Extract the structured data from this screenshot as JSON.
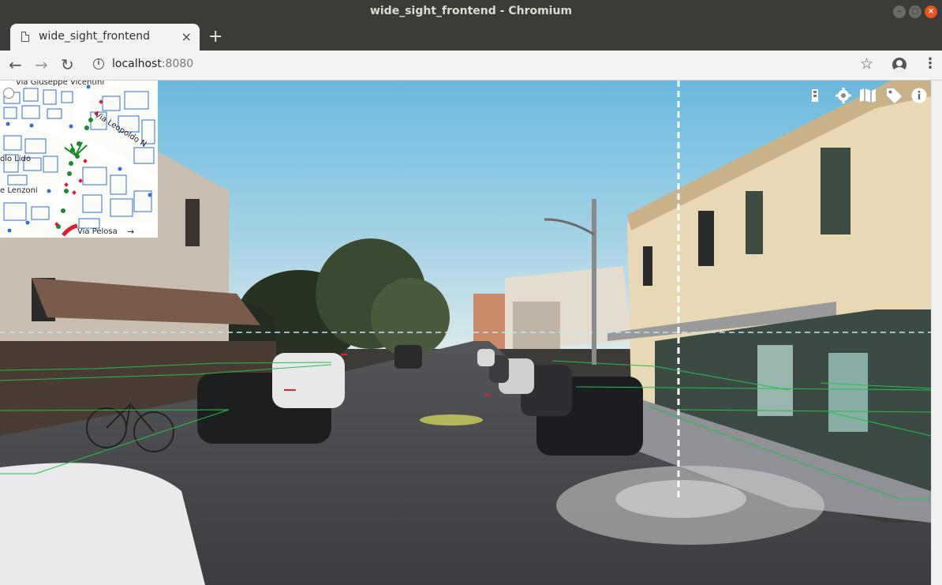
{
  "window": {
    "title": "wide_sight_frontend - Chromium"
  },
  "tab": {
    "label": "wide_sight_frontend",
    "close": "×"
  },
  "new_tab": "+",
  "toolbar": {
    "back": "←",
    "forward": "→",
    "reload": "↻",
    "url_host": "localhost",
    "url_port": ":8080",
    "bookmark": "☆",
    "menu": "⋮"
  },
  "viewer_icons": [
    "layers-icon",
    "settings-icon",
    "map-icon",
    "tag-icon",
    "info-icon"
  ],
  "minimap": {
    "streets": [
      "Via Giuseppe Vicentini",
      "Via Leopoldo N",
      "olo Lido",
      "e Lenzoni",
      "Via Pelosa"
    ],
    "arrow": "→"
  },
  "colors": {
    "map_building_stroke": "#2f6fd6",
    "map_point_green": "#1a8a2a",
    "map_point_red": "#e01b2d",
    "overlay_green": "#22c04a",
    "horizon_line": "#bde8f2"
  }
}
